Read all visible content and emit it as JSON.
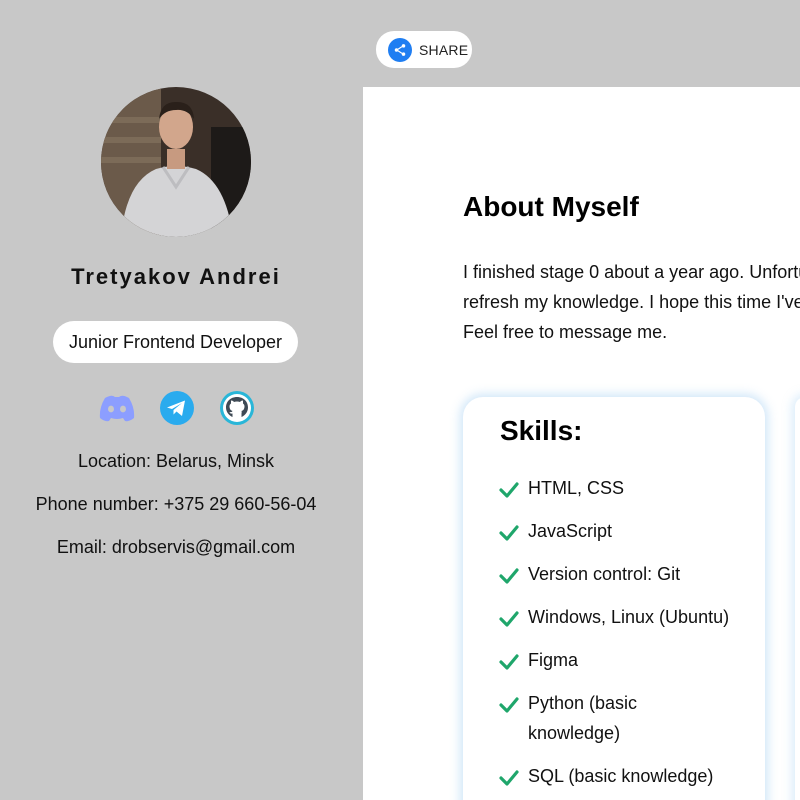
{
  "share": {
    "label": "SHARE",
    "icon": "share-icon"
  },
  "profile": {
    "name": "Tretyakov Andrei",
    "role": "Junior Frontend Developer",
    "socials": [
      {
        "icon": "discord-icon",
        "color": "#8c9eff"
      },
      {
        "icon": "telegram-icon",
        "color": "#2aabee"
      },
      {
        "icon": "github-icon",
        "color": "#29b6d8"
      }
    ],
    "location": "Location: Belarus, Minsk",
    "phone": "Phone number: +375 29 660-56-04",
    "email": "Email: drobservis@gmail.com"
  },
  "about": {
    "title": "About Myself",
    "lines": [
      "I finished stage 0 about a year ago. Unfortu",
      "refresh my knowledge. I hope this time I've",
      "Feel free to message me."
    ]
  },
  "skills": {
    "title": "Skills:",
    "items": [
      [
        "HTML, CSS"
      ],
      [
        "JavaScript"
      ],
      [
        "Version control: Git"
      ],
      [
        "Windows, Linux (Ubuntu)"
      ],
      [
        "Figma"
      ],
      [
        "Python (basic",
        "knowledge)"
      ],
      [
        "SQL (basic knowledge)"
      ]
    ]
  },
  "colors": {
    "sidebar_bg": "#c8c8c8",
    "accent_blue": "#1f7ef2",
    "check_green": "#1fa66b"
  }
}
